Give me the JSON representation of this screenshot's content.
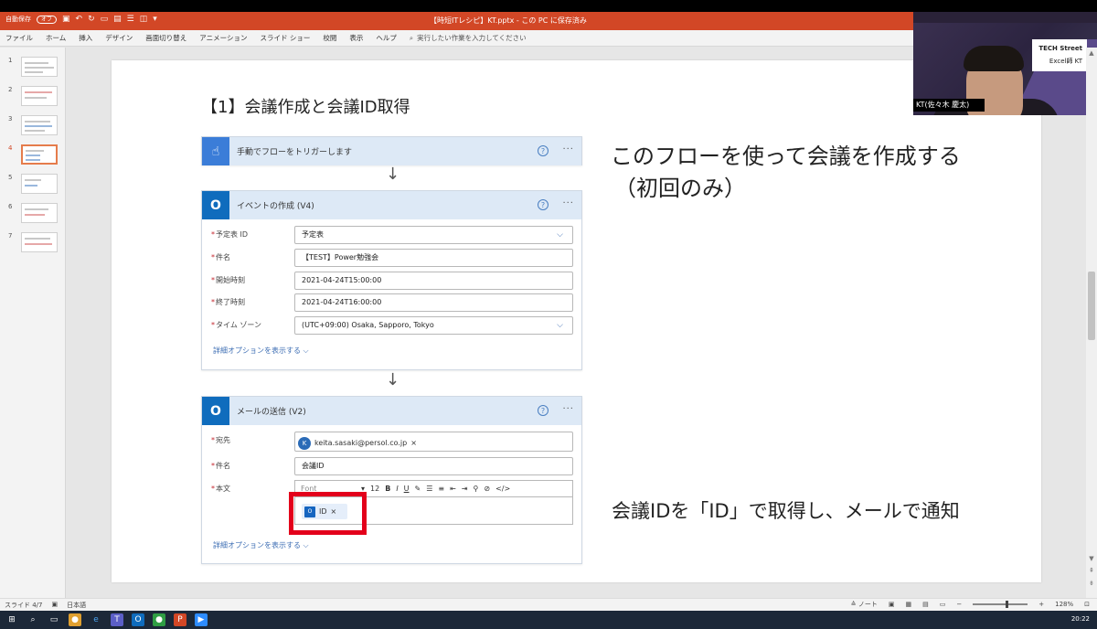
{
  "window": {
    "autosave_label": "自動保存",
    "autosave_state": "オフ",
    "document_title": "【時短ITレシピ】KT.pptx - この PC に保存済み"
  },
  "menu": {
    "items": [
      "ファイル",
      "ホーム",
      "挿入",
      "デザイン",
      "画面切り替え",
      "アニメーション",
      "スライド ショー",
      "校閲",
      "表示",
      "ヘルプ"
    ],
    "search_placeholder": "実行したい作業を入力してください"
  },
  "thumbnails": {
    "numbers": [
      "1",
      "2",
      "3",
      "4",
      "5",
      "6",
      "7"
    ],
    "active": "4"
  },
  "slide": {
    "heading": "【1】会議作成と会議ID取得",
    "note_1_line1": "このフローを使って会議を作成する",
    "note_1_line2": "（初回のみ）",
    "note_2": "会議IDを「ID」で取得し、メールで通知"
  },
  "flow": {
    "trigger": {
      "title": "手動でフローをトリガーします"
    },
    "event": {
      "title": "イベントの作成 (V4)",
      "fields": [
        {
          "label": "予定表 ID",
          "value": "予定表",
          "dropdown": true
        },
        {
          "label": "件名",
          "value": "【TEST】Power勉強会",
          "dropdown": false
        },
        {
          "label": "開始時刻",
          "value": "2021-04-24T15:00:00",
          "dropdown": false
        },
        {
          "label": "終了時刻",
          "value": "2021-04-24T16:00:00",
          "dropdown": false
        },
        {
          "label": "タイム ゾーン",
          "value": "(UTC+09:00) Osaka, Sapporo, Tokyo",
          "dropdown": true
        }
      ],
      "advanced": "詳細オプションを表示する"
    },
    "mail": {
      "title": "メールの送信 (V2)",
      "to_label": "宛先",
      "to_avatar": "K",
      "to_value": "keita.sasaki@persol.co.jp",
      "subject_label": "件名",
      "subject_value": "会議ID",
      "body_label": "本文",
      "font_label": "Font",
      "font_size": "12",
      "token": "ID",
      "advanced": "詳細オプションを表示する"
    }
  },
  "webcam": {
    "brand_line1": "TECH Street",
    "brand_line2": "Excel師 KT",
    "name": "KT(佐々木 慶太)"
  },
  "status": {
    "slide_info": "スライド 4/7",
    "language": "日本語",
    "notes": "ノート",
    "zoom": "128%",
    "time": "20:22"
  },
  "colors": {
    "title_bar": "#d24726",
    "flow_header": "#dde9f6",
    "highlight": "#e3001b",
    "trigger_icon": "#3b7dd8",
    "outlook_icon": "#0f6cbd"
  }
}
